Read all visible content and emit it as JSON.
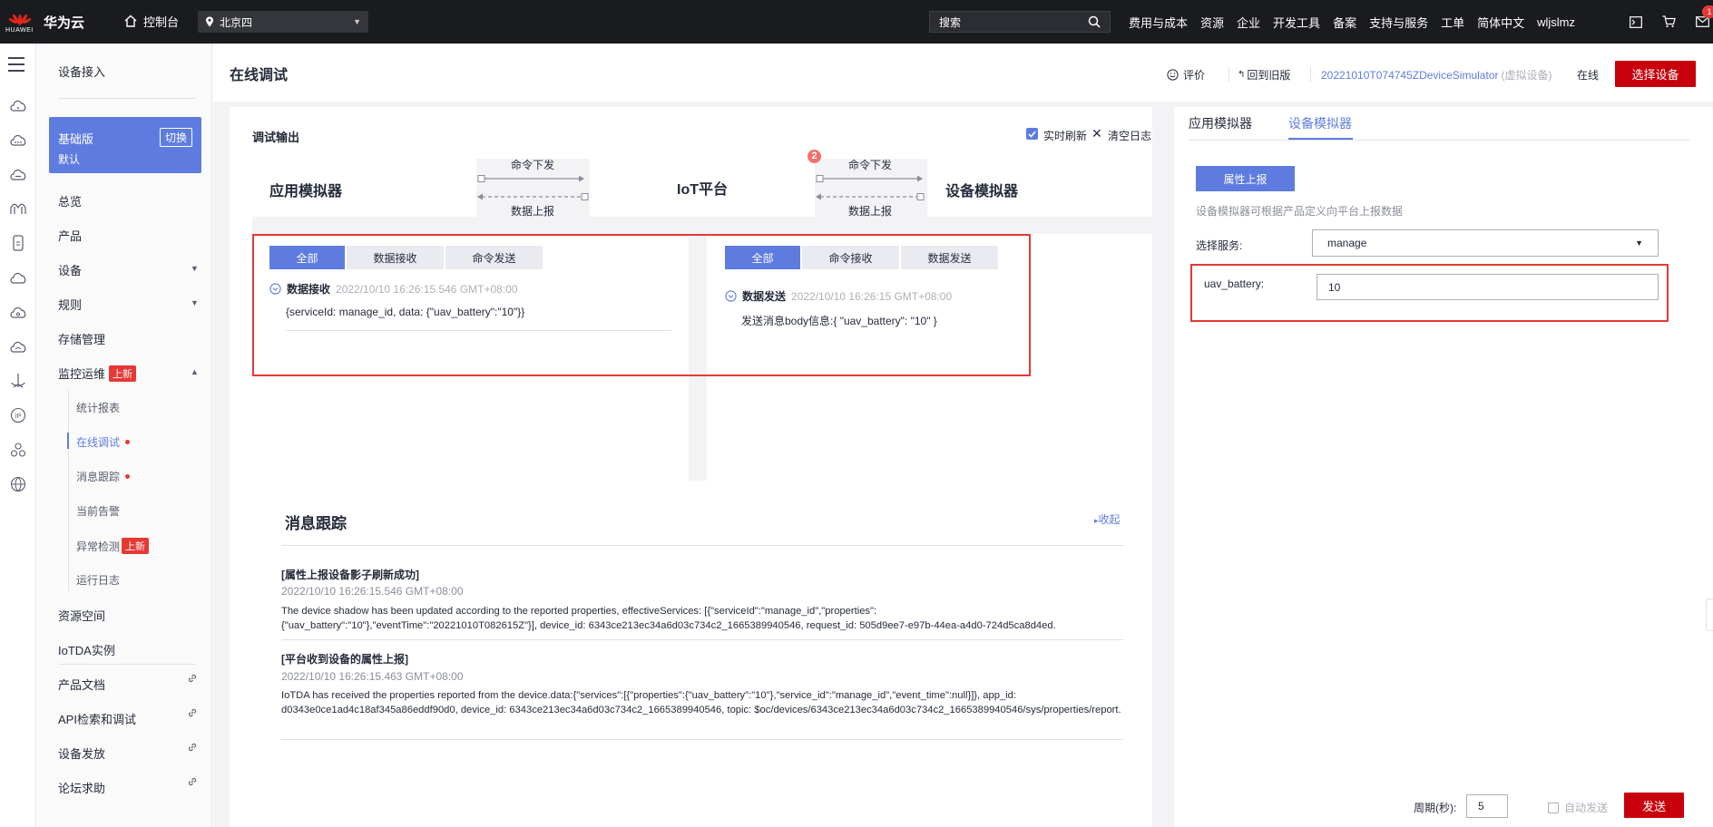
{
  "topbar": {
    "logo_text": "HUAWEI",
    "brand": "华为云",
    "console_label": "控制台",
    "region": "北京四",
    "search_placeholder": "搜索",
    "nav_links": [
      "费用与成本",
      "资源",
      "企业",
      "开发工具",
      "备案",
      "支持与服务",
      "工单",
      "简体中文",
      "wljslmz"
    ],
    "notification_count": "1"
  },
  "sidemenu": {
    "title": "设备接入",
    "edition": {
      "name": "基础版",
      "switch": "切换",
      "default": "默认"
    },
    "items": {
      "overview": "总览",
      "product": "产品",
      "device": "设备",
      "rules": "规则",
      "storage": "存储管理",
      "monitor": "监控运维",
      "monitor_tag": "上新",
      "stats": "统计报表",
      "online_debug": "在线调试",
      "msg_trace": "消息跟踪",
      "alarms": "当前告警",
      "anomaly": "异常检测",
      "anomaly_tag": "上新",
      "run_log": "运行日志",
      "resource_space": "资源空间",
      "iotda_instance": "IoTDA实例",
      "product_docs": "产品文档",
      "api_debug": "API检索和调试",
      "device_provision": "设备发放",
      "forum": "论坛求助"
    }
  },
  "header": {
    "title": "在线调试",
    "rate": "评价",
    "back_old": "回到旧版",
    "device_name": "20221010T074745ZDeviceSimulator",
    "device_tag": "(虚拟设备)",
    "status": "在线",
    "select_device": "选择设备"
  },
  "debug": {
    "title": "调试输出",
    "realtime_refresh": "实时刷新",
    "clear_log": "清空日志",
    "app_sim": "应用模拟器",
    "iot_platform": "IoT平台",
    "device_sim": "设备模拟器",
    "cmd_down": "命令下发",
    "data_up": "数据上报",
    "step_badge": "2",
    "left_tabs": [
      "全部",
      "数据接收",
      "命令发送"
    ],
    "right_tabs": [
      "全部",
      "命令接收",
      "数据发送"
    ],
    "left_msg": {
      "kind": "数据接收",
      "time": "2022/10/10 16:26:15.546 GMT+08:00",
      "body": "{serviceId: manage_id, data: {\"uav_battery\":\"10\"}}"
    },
    "right_msg": {
      "kind": "数据发送",
      "time": "2022/10/10 16:26:15 GMT+08:00",
      "body": "发送消息body信息:{ \"uav_battery\": \"10\" }"
    }
  },
  "trace": {
    "title": "消息跟踪",
    "collapse": "收起",
    "entries": [
      {
        "head": "[属性上报设备影子刷新成功]",
        "time": "2022/10/10 16:26:15.546 GMT+08:00",
        "text": "The device shadow has been updated according to the reported properties, effectiveServices: [{\"serviceId\":\"manage_id\",\"properties\":{\"uav_battery\":\"10\"},\"eventTime\":\"20221010T082615Z\"}], device_id: 6343ce213ec34a6d03c734c2_1665389940546, request_id: 505d9ee7-e97b-44ea-a4d0-724d5ca8d4ed."
      },
      {
        "head": "[平台收到设备的属性上报]",
        "time": "2022/10/10 16:26:15.463 GMT+08:00",
        "text": "IoTDA has received the properties reported from the device.data:{\"services\":[{\"properties\":{\"uav_battery\":\"10\"},\"service_id\":\"manage_id\",\"event_time\":null}]}, app_id: d0343e0ce1ad4c18af345a86eddf90d0, device_id: 6343ce213ec34a6d03c734c2_1665389940546, topic: $oc/devices/6343ce213ec34a6d03c734c2_1665389940546/sys/properties/report."
      }
    ]
  },
  "simulator": {
    "tabs": [
      "应用模拟器",
      "设备模拟器"
    ],
    "report_button": "属性上报",
    "hint": "设备模拟器可根据产品定义向平台上报数据",
    "service_label": "选择服务:",
    "service_value": "manage",
    "property_label": "uav_battery:",
    "property_value": "10",
    "period_label": "周期(秒):",
    "period_value": "5",
    "auto_send": "自动发送",
    "send_button": "发送"
  }
}
